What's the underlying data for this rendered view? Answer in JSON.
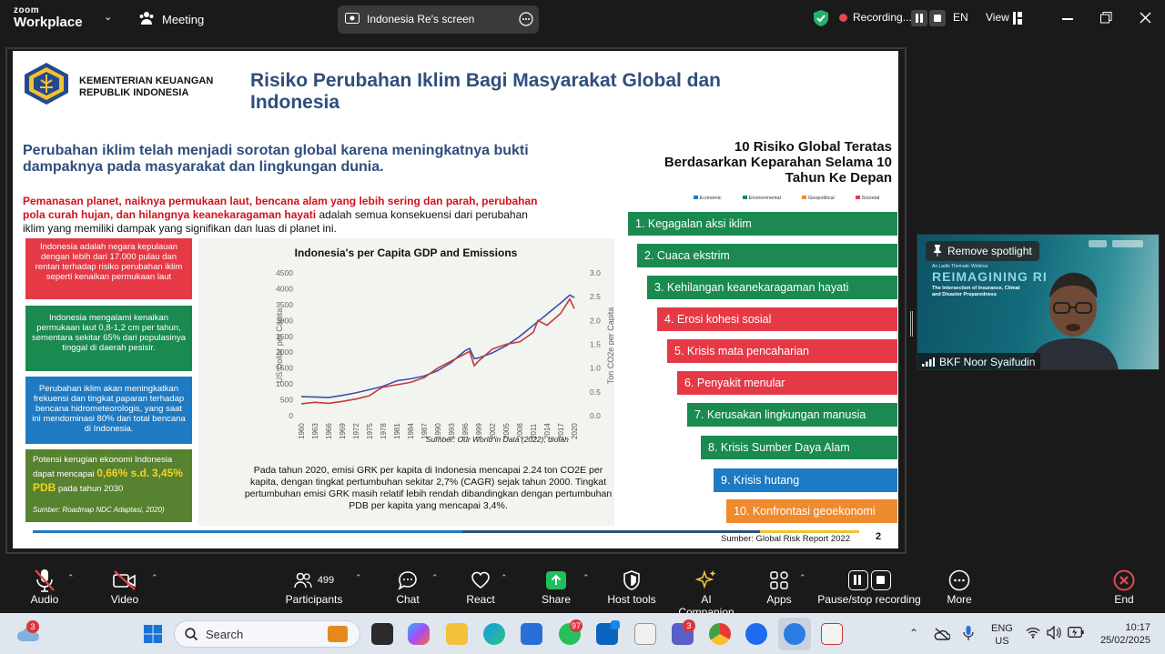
{
  "topbar": {
    "logo_top": "zoom",
    "logo_bottom": "Workplace",
    "meeting_label": "Meeting",
    "share_label": "Indonesia Re's screen",
    "recording_label": "Recording...",
    "lang": "EN",
    "view_label": "View"
  },
  "slide": {
    "ministry_line1": "KEMENTERIAN KEUANGAN",
    "ministry_line2": "REPUBLIK INDONESIA",
    "title_line1": "Risiko Perubahan Iklim Bagi Masyarakat Global dan",
    "title_line2": "Indonesia",
    "intro_line1": "Perubahan iklim telah menjadi sorotan global karena meningkatnya bukti",
    "intro_line2": "dampaknya pada masyarakat dan lingkungan dunia.",
    "red_line1": "Pemanasan planet, naiknya permukaan laut, bencana alam yang lebih sering dan parah, perubahan",
    "red_line2": "pola curah hujan, dan hilangnya keanekaragaman hayati",
    "black_line2": " adalah semua konsekuensi dari perubahan",
    "black_line3": "iklim yang memiliki dampak yang signifikan dan luas di planet ini.",
    "box1": "Indonesia adalah negara kepulauan dengan lebih dari 17.000 pulau dan rentan terhadap risiko perubahan iklim seperti kenaikan permukaan laut",
    "box2": "Indonesia mengalami kenaikan permukaan laut 0,8-1,2 cm per tahun, sementara sekitar 65% dari populasinya tinggal di daerah pesisir.",
    "box3": "Perubahan iklim akan meningkatkan frekuensi dan tingkat paparan terhadap bencana hidrometeorologis, yang saat ini mendominasi 80% dari total bencana di Indonesia.",
    "box4_pre": "Potensi kerugian ekonomi Indonesia dapat mencapai",
    "box4_highlight1": "0,66% s.d.",
    "box4_highlight2": "3,45% PDB",
    "box4_post": "pada tahun 2030",
    "box4_source": "Sumber: Roadmap NDC Adaptasi, 2020)",
    "chart_source": "Sumber: Our World in Data (2022), diolah",
    "chart_note": "Pada tahun 2020, emisi GRK per kapita di Indonesia mencapai 2.24 ton CO2E per kapita, dengan tingkat pertumbuhan sekitar 2,7% (CAGR) sejak tahun 2000. Tingkat pertumbuhan emisi GRK masih relatif lebih rendah dibandingkan dengan pertumbuhan PDB per kapita yang mencapai 3,4%.",
    "risk_title_line1": "10 Risiko Global Teratas",
    "risk_title_line2": "Berdasarkan Keparahan Selama 10",
    "risk_title_line3": "Tahun Ke Depan",
    "legend": [
      "Economic",
      "Environmental",
      "Geopolitical",
      "Societal"
    ],
    "risks": [
      "1. Kegagalan aksi iklim",
      "2. Cuaca ekstrim",
      "3. Kehilangan keanekaragaman hayati",
      "4. Erosi kohesi sosial",
      "5. Krisis mata pencaharian",
      "6. Penyakit menular",
      "7. Kerusakan lingkungan manusia",
      "8. Krisis Sumber Daya Alam",
      "9. Krisis hutang",
      "10. Konfrontasi geoekonomi"
    ],
    "risk_source": "Sumber: Global Risk Report 2022",
    "page_number": "2"
  },
  "colors": {
    "economic": "#1e7ac2",
    "environmental": "#1a8a50",
    "geopolitical": "#ef8a2e",
    "societal": "#e63946",
    "title_blue": "#2f4e7c"
  },
  "chart_data": {
    "type": "line",
    "title": "Indonesia's per Capita GDP and Emissions",
    "ylabel": "US Dollar per Capita",
    "y2label": "Ton CO2e per Capita",
    "ylim": [
      0,
      4500
    ],
    "y2lim": [
      0,
      3.0
    ],
    "yticks": [
      "4500",
      "4000",
      "3500",
      "3000",
      "2500",
      "2000",
      "1500",
      "1000",
      "500",
      "0"
    ],
    "y2ticks": [
      "3.0",
      "2.5",
      "2.0",
      "1.5",
      "1.0",
      "0.5",
      "0.0"
    ],
    "xticks": [
      "1960",
      "1963",
      "1966",
      "1969",
      "1972",
      "1975",
      "1978",
      "1981",
      "1984",
      "1987",
      "1990",
      "1993",
      "1996",
      "1999",
      "2002",
      "2005",
      "2008",
      "2011",
      "2014",
      "2017",
      "2020"
    ],
    "series": [
      {
        "color": "#3d4fb0",
        "axis": "left",
        "x": [
          1960,
          1963,
          1966,
          1969,
          1972,
          1975,
          1978,
          1981,
          1984,
          1987,
          1990,
          1993,
          1996,
          1997,
          1998,
          1999,
          2002,
          2005,
          2008,
          2011,
          2014,
          2017,
          2019,
          2020
        ],
        "values": [
          600,
          590,
          570,
          640,
          720,
          820,
          930,
          1100,
          1160,
          1250,
          1420,
          1680,
          2050,
          2120,
          1800,
          1820,
          1980,
          2200,
          2500,
          2850,
          3200,
          3550,
          3800,
          3720
        ]
      },
      {
        "color": "#c8383c",
        "axis": "right",
        "x": [
          1960,
          1963,
          1966,
          1969,
          1972,
          1975,
          1977,
          1978,
          1981,
          1984,
          1987,
          1990,
          1993,
          1996,
          1997,
          1998,
          1999,
          2002,
          2005,
          2008,
          2011,
          2012,
          2014,
          2017,
          2019,
          2020
        ],
        "values": [
          0.25,
          0.28,
          0.26,
          0.3,
          0.35,
          0.42,
          0.55,
          0.6,
          0.65,
          0.7,
          0.8,
          1.0,
          1.15,
          1.3,
          1.35,
          1.05,
          1.15,
          1.4,
          1.5,
          1.55,
          1.75,
          2.0,
          1.9,
          2.15,
          2.45,
          2.25
        ]
      }
    ]
  },
  "thumbnail": {
    "remove_spotlight": "Remove spotlight",
    "event_line1": "An Ladin Thematic Webinar",
    "banner": "REIMAGINING RI",
    "sub1": "The Intersection of Insurance, Climat",
    "sub2": "and Disaster Preparedness",
    "name": "BKF Noor Syaifudin"
  },
  "bottombar": {
    "audio": "Audio",
    "video": "Video",
    "participants": "Participants",
    "participants_count": "499",
    "chat": "Chat",
    "react": "React",
    "share": "Share",
    "host_tools": "Host tools",
    "ai": "AI Companion",
    "apps": "Apps",
    "pause": "Pause/stop recording",
    "more": "More",
    "end": "End"
  },
  "taskbar": {
    "weather_badge": "3",
    "search": "Search",
    "whatsapp_badge": "97",
    "teams_badge": "3",
    "lang1": "ENG",
    "lang2": "US",
    "time": "10:17",
    "date": "25/02/2025"
  }
}
